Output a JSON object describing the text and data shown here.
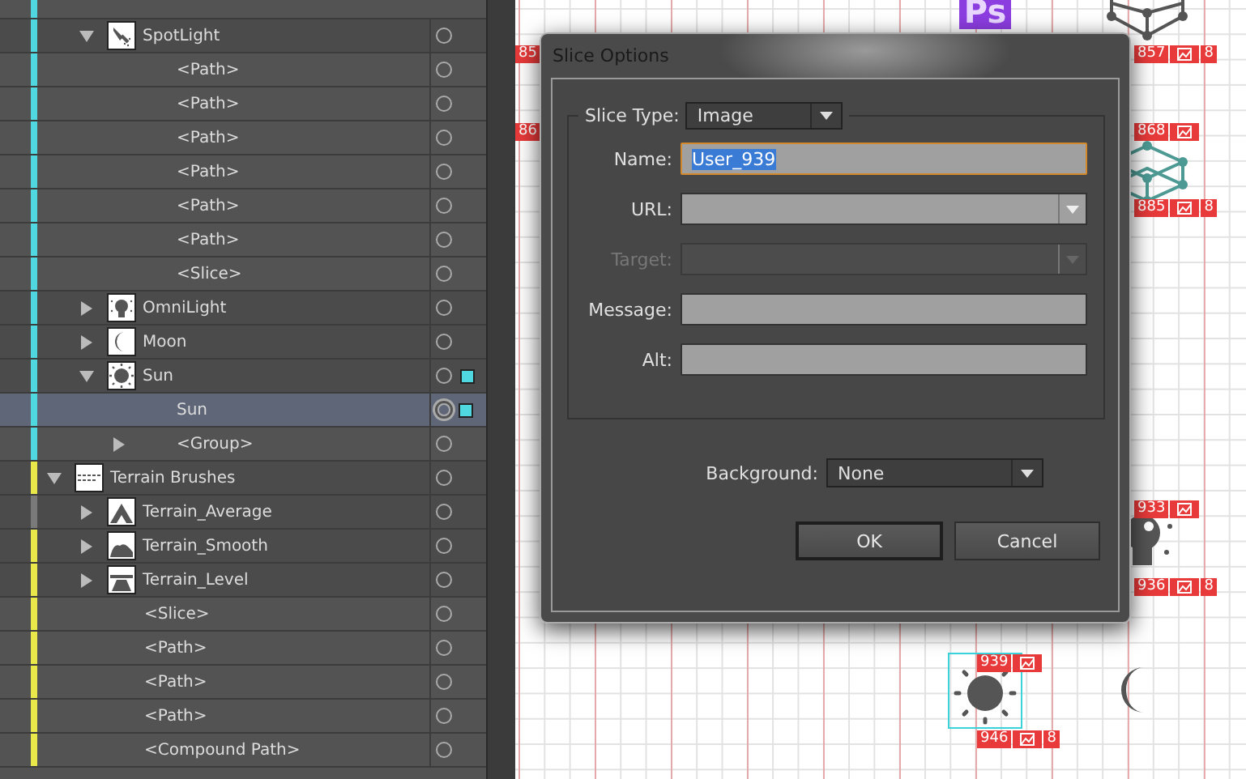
{
  "layers": [
    {
      "children": [
        {
          "label": "SpotLight",
          "kind": "spot",
          "expanded": true,
          "color": "#4fd8e0",
          "selected": false,
          "art_selected": false,
          "children": [
            {
              "label": "<Path>",
              "color": "#4fd8e0",
              "selected": false,
              "art_selected": false
            },
            {
              "label": "<Path>",
              "color": "#4fd8e0",
              "selected": false,
              "art_selected": false
            },
            {
              "label": "<Path>",
              "color": "#4fd8e0",
              "selected": false,
              "art_selected": false
            },
            {
              "label": "<Path>",
              "color": "#4fd8e0",
              "selected": false,
              "art_selected": false
            },
            {
              "label": "<Path>",
              "color": "#4fd8e0",
              "selected": false,
              "art_selected": false
            },
            {
              "label": "<Path>",
              "color": "#4fd8e0",
              "selected": false,
              "art_selected": false
            },
            {
              "label": "<Slice>",
              "color": "#4fd8e0",
              "selected": false,
              "art_selected": false
            }
          ]
        },
        {
          "label": "OmniLight",
          "kind": "omni",
          "expanded": false,
          "color": "#4fd8e0",
          "selected": false,
          "art_selected": false
        },
        {
          "label": "Moon",
          "kind": "moon",
          "expanded": false,
          "color": "#4fd8e0",
          "selected": false,
          "art_selected": false
        },
        {
          "label": "Sun",
          "kind": "sun",
          "expanded": true,
          "color": "#4fd8e0",
          "selected": false,
          "art_selected": true,
          "children": [
            {
              "label": "Sun",
              "color": "#4fd8e0",
              "selected": true,
              "art_selected": true
            },
            {
              "label": "<Group>",
              "expanded": false,
              "color": "#4fd8e0",
              "selected": false,
              "art_selected": false
            }
          ]
        }
      ]
    },
    {
      "label": "Terrain Brushes",
      "kind": "brush-set",
      "expanded": true,
      "color": "#e8e84a",
      "selected": false,
      "art_selected": false,
      "children": [
        {
          "label": "Terrain_Average",
          "kind": "brush-average",
          "expanded": false,
          "color": "#7a7a7a",
          "selected": false,
          "art_selected": false
        },
        {
          "label": "Terrain_Smooth",
          "kind": "brush-smooth",
          "expanded": false,
          "color": "#e8e84a",
          "selected": false,
          "art_selected": false
        },
        {
          "label": "Terrain_Level",
          "kind": "brush-level",
          "expanded": false,
          "color": "#e8e84a",
          "selected": false,
          "art_selected": false
        },
        {
          "label": "<Slice>",
          "color": "#e8e84a",
          "selected": false,
          "art_selected": false
        },
        {
          "label": "<Path>",
          "color": "#e8e84a",
          "selected": false,
          "art_selected": false
        },
        {
          "label": "<Path>",
          "color": "#e8e84a",
          "selected": false,
          "art_selected": false
        },
        {
          "label": "<Path>",
          "color": "#e8e84a",
          "selected": false,
          "art_selected": false
        },
        {
          "label": "<Compound Path>",
          "color": "#e8e84a",
          "selected": false,
          "art_selected": false
        }
      ]
    }
  ],
  "canvas": {
    "slice_tags": [
      {
        "number": "85"
      },
      {
        "number": "86"
      },
      {
        "number": "857",
        "image_icon": true,
        "count": "8"
      },
      {
        "number": "868",
        "image_icon": true
      },
      {
        "number": "885",
        "image_icon": true,
        "count": "8"
      },
      {
        "number": "933",
        "image_icon": true
      },
      {
        "number": "936",
        "image_icon": true,
        "count": "8"
      },
      {
        "number": "939",
        "image_icon": true
      },
      {
        "number": "946",
        "image_icon": true,
        "count": "8"
      }
    ],
    "logo_text": "Ps"
  },
  "dialog": {
    "title": "Slice Options",
    "slice_type": {
      "label": "Slice Type:",
      "value": "Image"
    },
    "fields": [
      {
        "kind": "text",
        "label": "Name:",
        "value": "User_939",
        "focused": true,
        "disabled": false
      },
      {
        "kind": "combo",
        "label": "URL:",
        "focused": false,
        "disabled": false
      },
      {
        "kind": "combo",
        "label": "Target:",
        "focused": false,
        "disabled": true
      },
      {
        "kind": "text",
        "label": "Message:",
        "focused": false,
        "disabled": false
      },
      {
        "kind": "text",
        "label": "Alt:",
        "focused": false,
        "disabled": false
      }
    ],
    "background": {
      "label": "Background:",
      "value": "None"
    },
    "buttons": [
      {
        "label": "OK",
        "default": true
      },
      {
        "label": "Cancel",
        "default": false
      }
    ]
  }
}
